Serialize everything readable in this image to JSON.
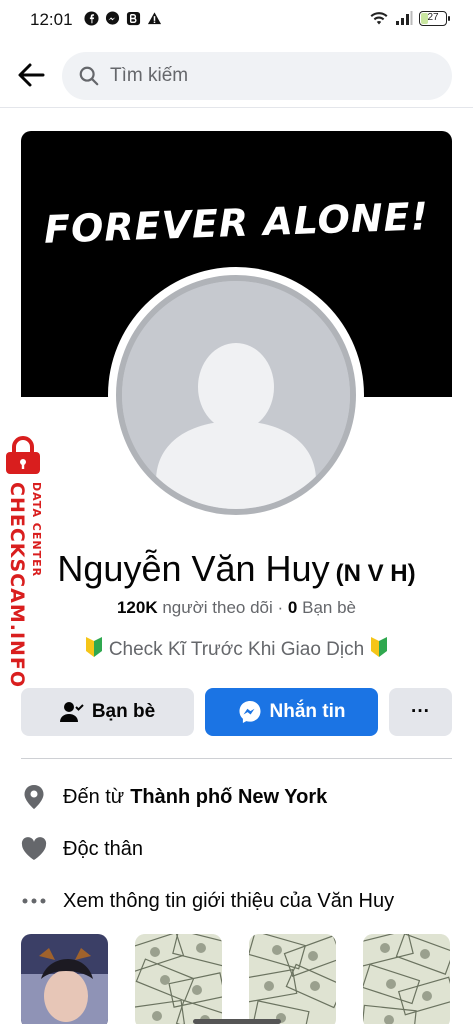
{
  "status_bar": {
    "time": "12:01",
    "battery": "27",
    "battery_level": 0.27,
    "icons": [
      "facebook-icon",
      "messenger-icon",
      "app-icon",
      "warning-icon",
      "wifi-icon",
      "signal-icon",
      "battery-icon"
    ]
  },
  "top_bar": {
    "search_placeholder": "Tìm kiếm",
    "icons": [
      "back-arrow-icon",
      "search-icon"
    ]
  },
  "cover": {
    "text": "FOREVER ALONE!"
  },
  "watermark": {
    "line1": "DATA CENTER",
    "line2": "CHECKSCAM.INFO",
    "color": "#d91e1e"
  },
  "profile": {
    "name": "Nguyễn Văn Huy",
    "nickname": "(N V H)",
    "followers_count": "120K",
    "followers_label": "người theo dõi",
    "separator": "·",
    "friends_count": "0",
    "friends_label": "Bạn bè",
    "bio": "Check Kĩ Trước Khi Giao Dịch"
  },
  "actions": {
    "friend_label": "Bạn bè",
    "message_label": "Nhắn tin",
    "more_label": "···"
  },
  "intro": {
    "from_prefix": "Đến từ",
    "from_place": "Thành phố New York",
    "relationship": "Độc thân",
    "see_more": "Xem thông tin giới thiệu của Văn Huy"
  },
  "colors": {
    "accent": "#1b74e4",
    "secondary_button": "#e4e6eb",
    "muted_text": "#65676b"
  }
}
